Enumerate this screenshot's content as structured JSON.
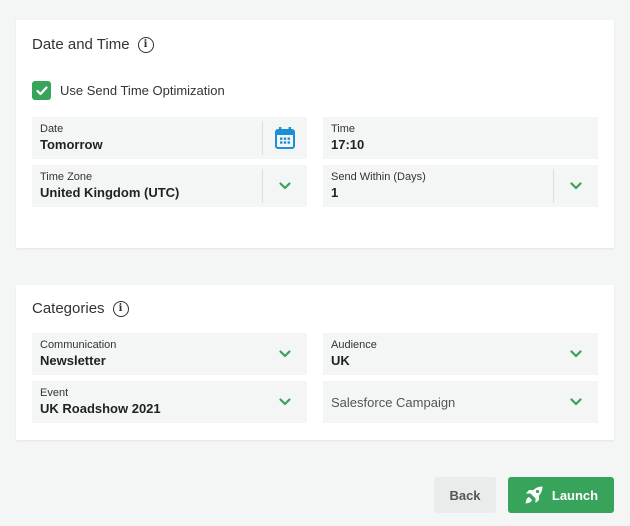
{
  "date_time": {
    "title": "Date and Time",
    "info_icon": "info-icon",
    "send_time_optimization": {
      "label": "Use Send Time Optimization",
      "checked": true
    },
    "fields": {
      "date": {
        "label": "Date",
        "value": "Tomorrow",
        "icon": "calendar-icon"
      },
      "time": {
        "label": "Time",
        "value": "17:10"
      },
      "time_zone": {
        "label": "Time Zone",
        "value": "United Kingdom (UTC)",
        "icon": "chevron-down-icon"
      },
      "send_within": {
        "label": "Send Within (Days)",
        "value": "1",
        "icon": "chevron-down-icon"
      }
    }
  },
  "categories": {
    "title": "Categories",
    "info_icon": "info-icon",
    "fields": {
      "communication": {
        "label": "Communication",
        "value": "Newsletter",
        "icon": "chevron-down-icon"
      },
      "audience": {
        "label": "Audience",
        "value": "UK",
        "icon": "chevron-down-icon"
      },
      "event": {
        "label": "Event",
        "value": "UK Roadshow 2021",
        "icon": "chevron-down-icon"
      },
      "salesforce_campaign": {
        "placeholder": "Salesforce Campaign",
        "icon": "chevron-down-icon"
      }
    }
  },
  "actions": {
    "back_label": "Back",
    "launch_label": "Launch",
    "launch_icon": "rocket-icon"
  },
  "colors": {
    "accent": "#38a35a",
    "calendar_icon": "#1a8fd6",
    "background": "#f4f5f5",
    "field_background": "#f4f5f5"
  }
}
